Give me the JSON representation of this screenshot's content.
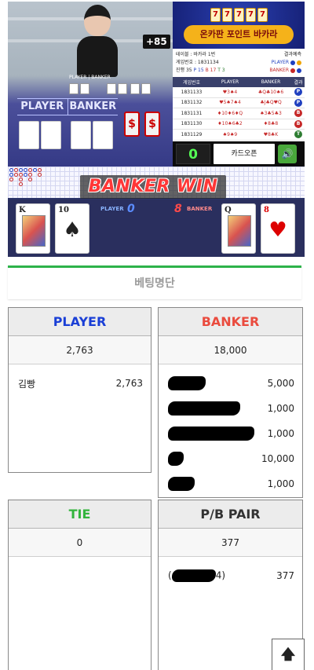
{
  "game": {
    "bet_badge": "+85",
    "video_labels": {
      "player": "PLAYER",
      "banker": "BANKER"
    },
    "sign": {
      "player": "PLAYER",
      "banker": "BANKER"
    },
    "banner_title": "온카판 포인트 바카라",
    "meta": {
      "table_label": "테이블 : 바카라 1번",
      "prediction_label": "결과예측",
      "game_number_label": "게임번호 : 1831134",
      "player_label": "PLAYER",
      "banker_label": "BANKER",
      "progress_label": "진행 35",
      "p_count": "P 15",
      "b_count": "B 17",
      "t_count": "T 3"
    },
    "history_columns": [
      "게임번호",
      "PLAYER",
      "BANKER",
      "결과"
    ],
    "history_rows": [
      {
        "game": "1831133",
        "player": "♥3♠4",
        "banker": "♣Q♣10♠6",
        "result": "P",
        "result_color": "#1f3fbf"
      },
      {
        "game": "1831132",
        "player": "♥5♠7♠4",
        "banker": "♣J♣Q♥Q",
        "result": "P",
        "result_color": "#1f3fbf"
      },
      {
        "game": "1831131",
        "player": "♦10♦6♦Q",
        "banker": "♠3♣5♣3",
        "result": "B",
        "result_color": "#c62828"
      },
      {
        "game": "1831130",
        "player": "♦10♠6♣2",
        "banker": "♦8♣8",
        "result": "B",
        "result_color": "#c62828"
      },
      {
        "game": "1831129",
        "player": "♠9♠9",
        "banker": "♥8♣K",
        "result": "T",
        "result_color": "#2e7d32"
      }
    ],
    "count_value": "0",
    "card_open_label": "카드오픈",
    "sound_icon": "speaker-icon",
    "win_text": "BANKER WIN",
    "result": {
      "player_label": "PLAYER",
      "player_score": "0",
      "banker_label": "BANKER",
      "banker_score": "8",
      "player_cards": [
        {
          "rank": "K",
          "suit": "♣"
        },
        {
          "rank": "10",
          "suit": "♠"
        }
      ],
      "banker_cards": [
        {
          "rank": "Q",
          "suit": "♠"
        },
        {
          "rank": "8",
          "suit": "♥"
        }
      ]
    }
  },
  "betting": {
    "title": "베팅명단",
    "player": {
      "label": "PLAYER",
      "color": "#1a3fd6",
      "total": "2,763",
      "rows": [
        {
          "name": "김빵",
          "amount": "2,763",
          "masked": false
        }
      ]
    },
    "banker": {
      "label": "BANKER",
      "color": "#ea4b3e",
      "total": "18,000",
      "rows": [
        {
          "amount": "5,000",
          "masked": true
        },
        {
          "amount": "1,000",
          "masked": true
        },
        {
          "amount": "1,000",
          "masked": true
        },
        {
          "amount": "10,000",
          "masked": true
        },
        {
          "amount": "1,000",
          "masked": true
        }
      ]
    },
    "tie": {
      "label": "TIE",
      "color": "#33b43d",
      "total": "0"
    },
    "pair": {
      "label": "P/B PAIR",
      "color": "#333333",
      "total": "377",
      "rows": [
        {
          "name_prefix": "(",
          "name_suffix": "4)",
          "amount": "377",
          "masked": true
        }
      ]
    }
  },
  "scroll_top_icon": "arrow-up-icon",
  "scroll_top_glyph": "🡅"
}
